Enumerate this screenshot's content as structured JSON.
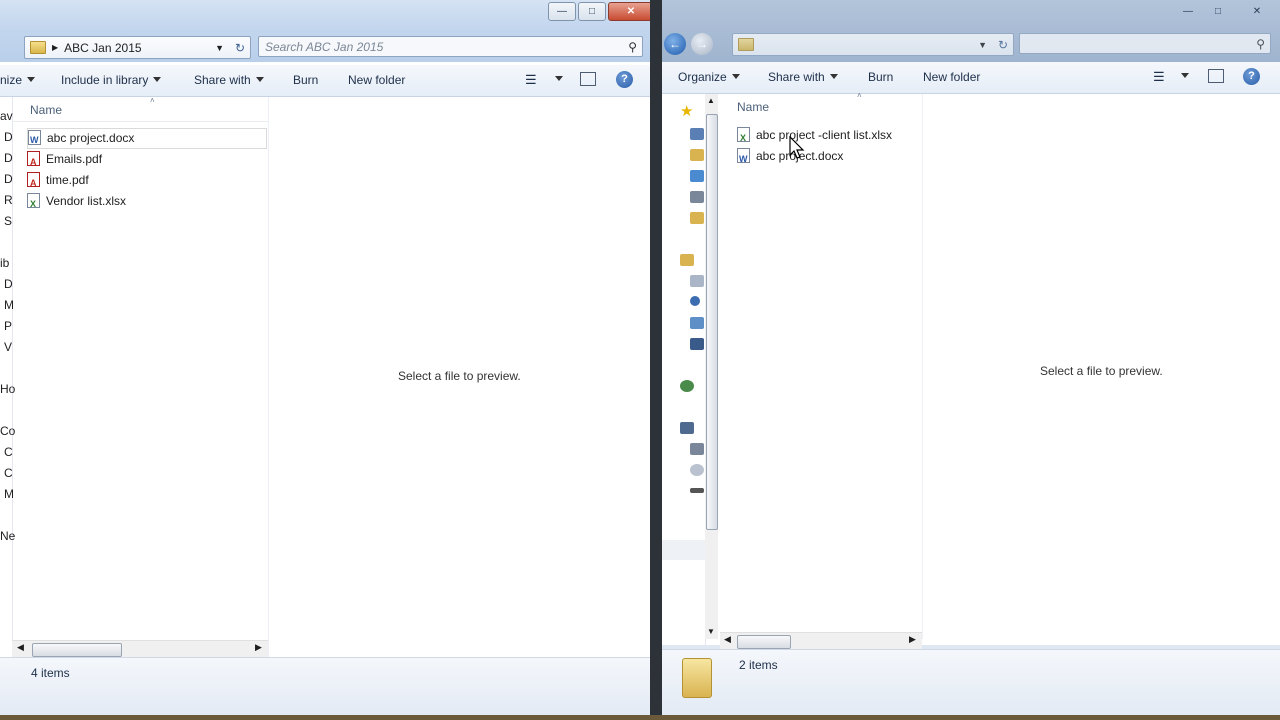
{
  "left_window": {
    "breadcrumb": "ABC Jan 2015",
    "search_placeholder": "Search ABC Jan 2015",
    "toolbar": {
      "organize": "nize",
      "include": "Include in library",
      "share": "Share with",
      "burn": "Burn",
      "new_folder": "New folder"
    },
    "column_header": "Name",
    "files": [
      {
        "name": "abc project.docx",
        "type": "doc"
      },
      {
        "name": "Emails.pdf",
        "type": "pdf"
      },
      {
        "name": "time.pdf",
        "type": "pdf"
      },
      {
        "name": "Vendor list.xlsx",
        "type": "xls"
      }
    ],
    "nav_letters": [
      "av",
      "D",
      "D",
      "D",
      "R",
      "S",
      "ib",
      "D",
      "M",
      "P",
      "V",
      "Ho",
      "Co",
      "C",
      "C",
      "M",
      "Ne"
    ],
    "preview_text": "Select a file to preview.",
    "status": "4 items"
  },
  "right_window": {
    "toolbar": {
      "organize": "Organize",
      "share": "Share with",
      "burn": "Burn",
      "new_folder": "New folder"
    },
    "column_header": "Name",
    "files": [
      {
        "name": "abc project -client list.xlsx",
        "type": "xls"
      },
      {
        "name": "abc project.docx",
        "type": "doc"
      }
    ],
    "preview_text": "Select a file to preview.",
    "status": "2 items"
  },
  "icons": {
    "back": "back-arrow-icon",
    "forward": "forward-arrow-icon",
    "help": "help-icon",
    "views": "views-icon",
    "preview_pane": "preview-pane-icon"
  }
}
